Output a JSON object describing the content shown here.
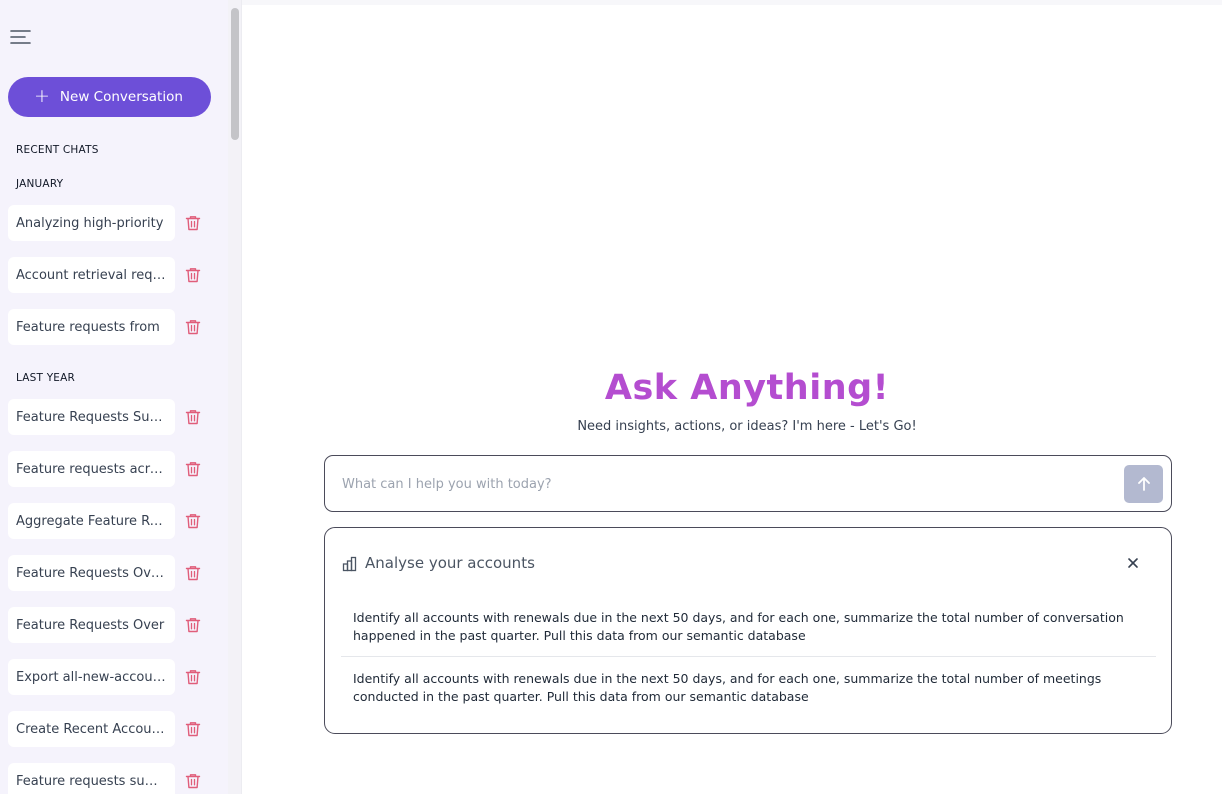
{
  "sidebar": {
    "new_conversation_label": "New Conversation",
    "recent_chats_heading": "RECENT CHATS",
    "groups": [
      {
        "label": "JANUARY",
        "items": [
          "Analyzing high-priority",
          "Account retrieval request",
          "Feature requests from"
        ]
      },
      {
        "label": "LAST YEAR",
        "items": [
          "Feature Requests Summary",
          "Feature requests across",
          "Aggregate Feature Requests",
          "Feature Requests Overview",
          "Feature Requests Over",
          "Export all-new-accounts",
          "Create Recent Accounts",
          "Feature requests summary"
        ]
      }
    ]
  },
  "main": {
    "title": "Ask Anything!",
    "subtitle": "Need insights, actions, or ideas? I'm here - Let's Go!",
    "input_placeholder": "What can I help you with today?",
    "suggestion_card": {
      "title": "Analyse your accounts",
      "icon": "bar-chart-icon",
      "suggestions": [
        "Identify all accounts with renewals due in the next 50 days, and for each one, summarize the total number of conversation happened in the past quarter. Pull this data from our semantic database",
        "Identify all accounts with renewals due in the next 50 days, and for each one, summarize the total number of meetings conducted in the past quarter. Pull this data from our semantic database"
      ]
    }
  },
  "colors": {
    "accent": "#6d4fd8",
    "title": "#b44dd0",
    "trash": "#e05d7a",
    "sidebar_bg": "#f5f3fc",
    "send_button_disabled": "#b3b9d0"
  }
}
